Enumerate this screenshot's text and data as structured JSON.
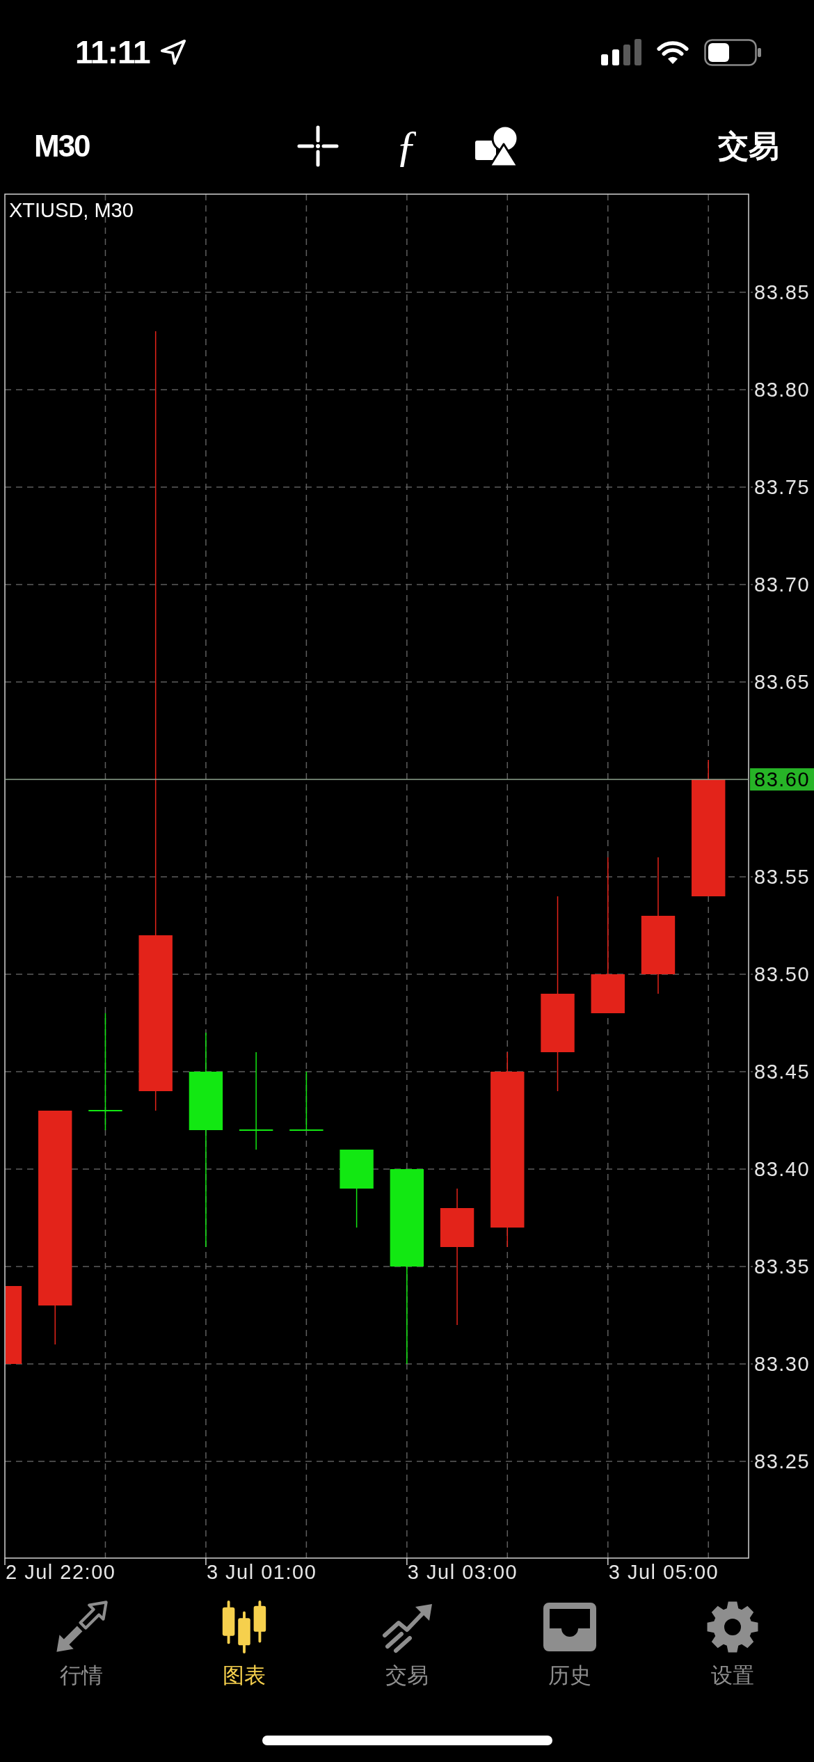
{
  "status_bar": {
    "time": "11:11"
  },
  "toolbar": {
    "timeframe": "M30",
    "indicator_symbol": "ƒ",
    "trade_label": "交易"
  },
  "chart": {
    "title": "XTIUSD, M30",
    "price_labels": [
      {
        "kind": "tick",
        "text": "83.85"
      },
      {
        "kind": "tick",
        "text": "83.80"
      },
      {
        "kind": "tick",
        "text": "83.75"
      },
      {
        "kind": "tick",
        "text": "83.70"
      },
      {
        "kind": "tick",
        "text": "83.65"
      },
      {
        "kind": "current",
        "text": "83.60"
      },
      {
        "kind": "tick",
        "text": "83.55"
      },
      {
        "kind": "tick",
        "text": "83.50"
      },
      {
        "kind": "tick",
        "text": "83.45"
      },
      {
        "kind": "tick",
        "text": "83.40"
      },
      {
        "kind": "tick",
        "text": "83.35"
      },
      {
        "kind": "tick",
        "text": "83.30"
      },
      {
        "kind": "tick",
        "text": "83.25"
      }
    ],
    "time_labels": [
      "2 Jul 22:00",
      "3 Jul 01:00",
      "3 Jul 03:00",
      "3 Jul 05:00"
    ]
  },
  "tab_bar": {
    "tabs": [
      {
        "label": "行情",
        "selected": false
      },
      {
        "label": "图表",
        "selected": true
      },
      {
        "label": "交易",
        "selected": false
      },
      {
        "label": "历史",
        "selected": false
      },
      {
        "label": "设置",
        "selected": false
      }
    ]
  }
}
